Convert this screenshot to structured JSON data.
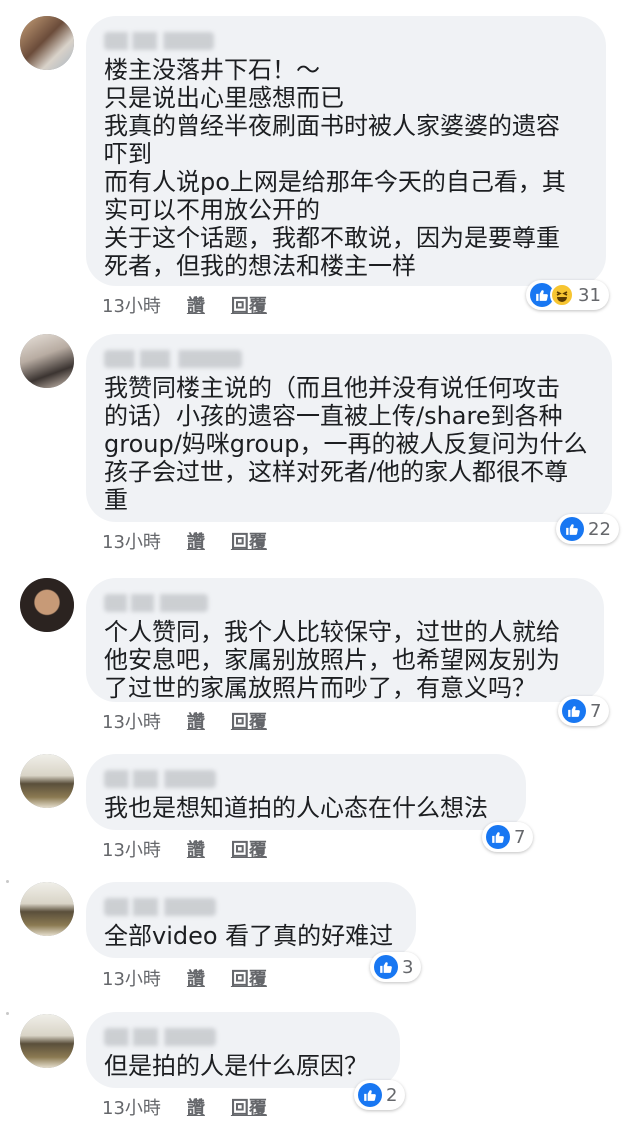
{
  "comments": [
    {
      "text": "楼主没落井下石！～\n只是说出心里感想而已\n我真的曾经半夜刷面书时被人家婆婆的遗容\n吓到\n而有人说po上网是给那年今天的自己看，其\n实可以不用放公开的\n关于这个话题，我都不敢说，因为是要尊重\n死者，但我的想法和楼主一样",
      "time": "13小時",
      "like_label": "讚",
      "reply_label": "回覆",
      "reaction_count": "31",
      "reactions": [
        "like-icon",
        "haha-icon"
      ]
    },
    {
      "text": "我赞同楼主说的（而且他并没有说任何攻击\n的话）小孩的遗容一直被上传/share到各种\ngroup/妈咪group，一再的被人反复问为什么\n孩子会过世，这样对死者/他的家人都很不尊\n重",
      "time": "13小時",
      "like_label": "讚",
      "reply_label": "回覆",
      "reaction_count": "22",
      "reactions": [
        "like-icon"
      ]
    },
    {
      "text": "个人赞同，我个人比较保守，过世的人就给\n他安息吧，家属别放照片，也希望网友别为\n了过世的家属放照片而吵了，有意义吗？",
      "time": "13小時",
      "like_label": "讚",
      "reply_label": "回覆",
      "reaction_count": "7",
      "reactions": [
        "like-icon"
      ]
    },
    {
      "text": "我也是想知道拍的人心态在什么想法",
      "time": "13小時",
      "like_label": "讚",
      "reply_label": "回覆",
      "reaction_count": "7",
      "reactions": [
        "like-icon"
      ]
    },
    {
      "text": "全部video 看了真的好难过",
      "time": "13小時",
      "like_label": "讚",
      "reply_label": "回覆",
      "reaction_count": "3",
      "reactions": [
        "like-icon"
      ]
    },
    {
      "text": "但是拍的人是什么原因？",
      "time": "13小時",
      "like_label": "讚",
      "reply_label": "回覆",
      "reaction_count": "2",
      "reactions": [
        "like-icon"
      ]
    }
  ],
  "colors": {
    "bubble": "#f0f2f5",
    "meta_text": "#65676b",
    "like_blue": "#1877f2",
    "haha_yellow": "#f7c531"
  }
}
